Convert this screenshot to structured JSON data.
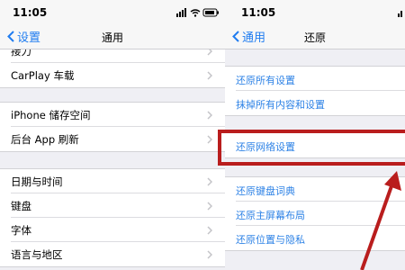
{
  "left": {
    "time": "11:05",
    "back_label": "设置",
    "title": "通用",
    "groups": [
      [
        "接力",
        "CarPlay 车载"
      ],
      [
        "iPhone 储存空间",
        "后台 App 刷新"
      ],
      [
        "日期与时间",
        "键盘",
        "字体",
        "语言与地区"
      ]
    ]
  },
  "right": {
    "time": "11:05",
    "back_label": "通用",
    "title": "还原",
    "groups": [
      [
        "还原所有设置",
        "抹掉所有内容和设置"
      ],
      [
        "还原网络设置"
      ],
      [
        "还原键盘词典",
        "还原主屏幕布局",
        "还原位置与隐私"
      ]
    ]
  },
  "annotation": {
    "color": "#b91d1d"
  },
  "colors": {
    "accent": "#1f7cf0"
  }
}
